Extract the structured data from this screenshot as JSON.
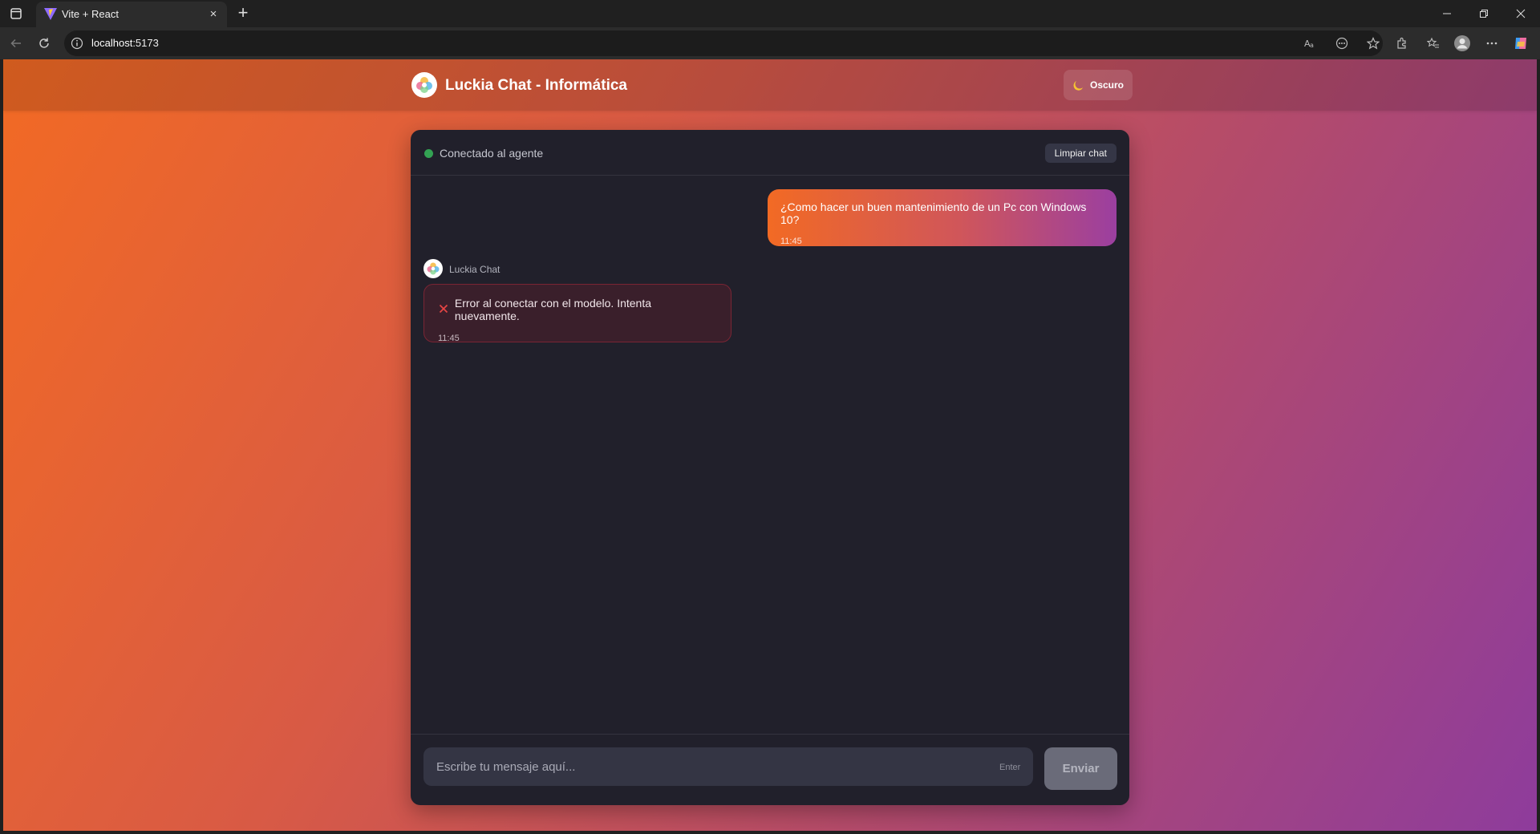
{
  "browser": {
    "tab_title": "Vite + React",
    "address": "localhost:5173",
    "address_host": "localhost",
    "address_port": ":5173",
    "tab_close": "×",
    "new_tab": "+"
  },
  "app": {
    "title": "Luckia Chat - Informática",
    "theme_label": "Oscuro",
    "theme_icon": "moon-icon"
  },
  "chat": {
    "status_text": "Conectado al agente",
    "status_color": "#33a253",
    "clear_label": "Limpiar chat",
    "messages": [
      {
        "role": "user",
        "text": "¿Como hacer un buen mantenimiento de un Pc con Windows 10?",
        "time": "11:45"
      },
      {
        "role": "bot",
        "sender": "Luckia Chat",
        "text": "Error al conectar con el modelo. Intenta nuevamente.",
        "time": "11:45",
        "status": "error",
        "icon": "error-x-icon"
      }
    ],
    "input_placeholder": "Escribe tu mensaje aquí...",
    "input_value": "",
    "enter_hint": "Enter",
    "send_label": "Enviar"
  },
  "colors": {
    "accent_orange": "#f26a24",
    "accent_purple": "#8e3c9c",
    "error_red": "#e84545",
    "card_bg": "#21202b"
  }
}
